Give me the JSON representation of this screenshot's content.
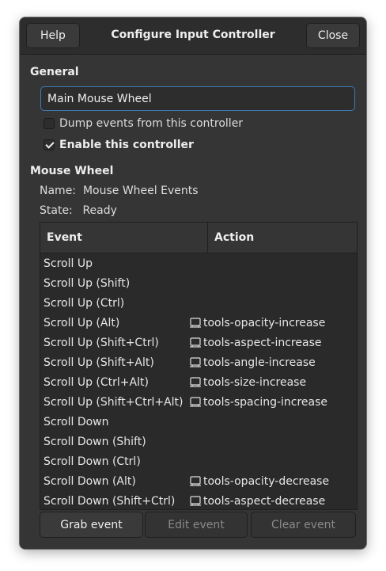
{
  "dialog": {
    "title": "Configure Input Controller",
    "help_label": "Help",
    "close_label": "Close"
  },
  "general": {
    "section_label": "General",
    "name_value": "Main Mouse Wheel",
    "dump_events_label": "Dump events from this controller",
    "dump_events_checked": false,
    "enable_label": "Enable this controller",
    "enable_checked": true
  },
  "mouse_wheel": {
    "section_label": "Mouse Wheel",
    "name_key": "Name:",
    "name_value": "Mouse Wheel Events",
    "state_key": "State:",
    "state_value": "Ready"
  },
  "table": {
    "headers": [
      "Event",
      "Action"
    ],
    "rows": [
      {
        "event": "Scroll Up",
        "action": ""
      },
      {
        "event": "Scroll Up (Shift)",
        "action": ""
      },
      {
        "event": "Scroll Up (Ctrl)",
        "action": ""
      },
      {
        "event": "Scroll Up (Alt)",
        "action": "tools-opacity-increase"
      },
      {
        "event": "Scroll Up (Shift+Ctrl)",
        "action": "tools-aspect-increase"
      },
      {
        "event": "Scroll Up (Shift+Alt)",
        "action": "tools-angle-increase"
      },
      {
        "event": "Scroll Up (Ctrl+Alt)",
        "action": "tools-size-increase"
      },
      {
        "event": "Scroll Up (Shift+Ctrl+Alt)",
        "action": "tools-spacing-increase"
      },
      {
        "event": "Scroll Down",
        "action": ""
      },
      {
        "event": "Scroll Down (Shift)",
        "action": ""
      },
      {
        "event": "Scroll Down (Ctrl)",
        "action": ""
      },
      {
        "event": "Scroll Down (Alt)",
        "action": "tools-opacity-decrease"
      },
      {
        "event": "Scroll Down (Shift+Ctrl)",
        "action": "tools-aspect-decrease"
      }
    ],
    "action_icon": "tool-icon"
  },
  "buttons": {
    "grab_label": "Grab event",
    "edit_label": "Edit event",
    "clear_label": "Clear event"
  },
  "colors": {
    "window_bg": "#353535",
    "accent_focus": "#3f79b5"
  }
}
